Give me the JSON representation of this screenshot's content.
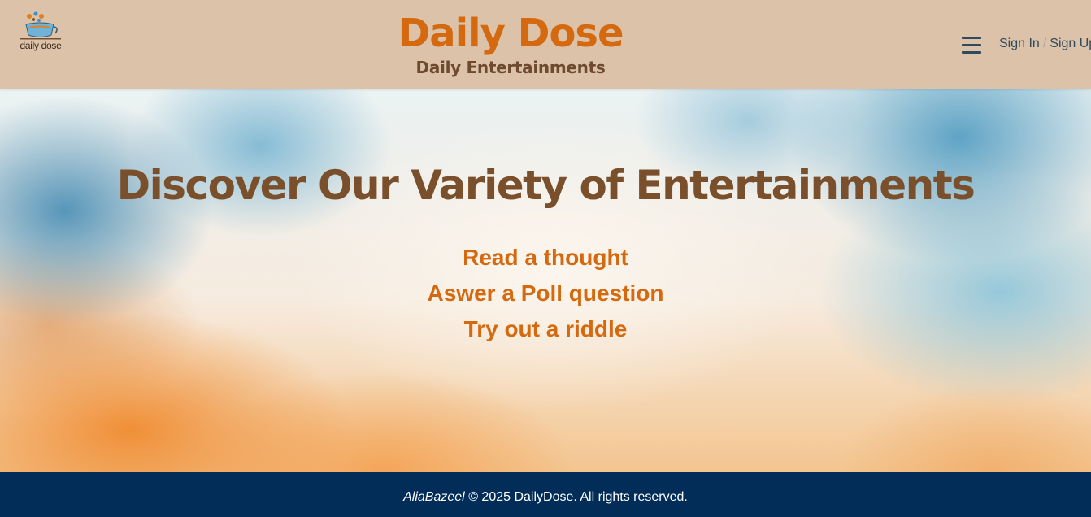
{
  "header": {
    "logo_caption": "daily dose",
    "brand_title": "Daily Dose",
    "brand_subtitle": "Daily Entertainments",
    "menu_icon": "hamburger-menu-icon",
    "sign_in": "Sign In",
    "separator": "/",
    "sign_up": "Sign Up"
  },
  "hero": {
    "title": "Discover Our Variety of Entertainments",
    "links": [
      "Read a thought",
      "Aswer a Poll question",
      "Try out a riddle"
    ]
  },
  "footer": {
    "author": "AliaBazeel",
    "copyright": "© 2025 DailyDose. All rights reserved."
  },
  "colors": {
    "header_bg": "#dbc2a8",
    "brand_orange": "#d4690f",
    "brand_brown": "#6e4a2e",
    "hero_title_brown": "#7a4f2b",
    "nav_text": "#2e4a5e",
    "footer_bg": "#012d58"
  }
}
